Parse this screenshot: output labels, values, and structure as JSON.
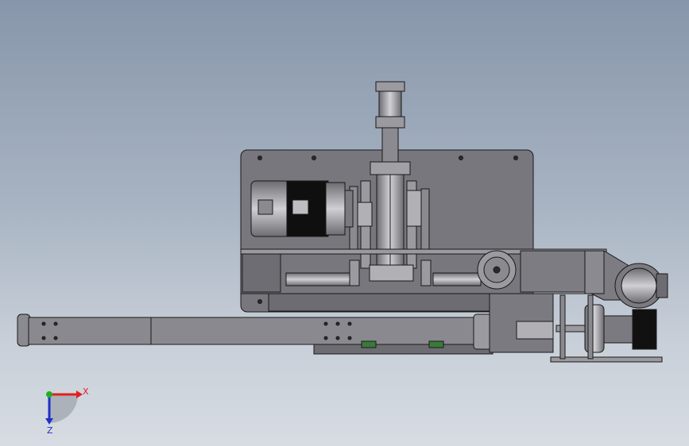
{
  "triad": {
    "x_label": "X",
    "z_label": "Z",
    "x_color": "#e02020",
    "z_color": "#2030c8",
    "y_color": "#20b020"
  },
  "colors": {
    "background_top": "#8796aa",
    "background_bottom": "#d7dce2",
    "part_face": "#8a8a90",
    "part_light": "#b9b9be",
    "part_dark": "#5a5a60",
    "edge": "#1a1a1a",
    "motor_black": "#101010"
  }
}
